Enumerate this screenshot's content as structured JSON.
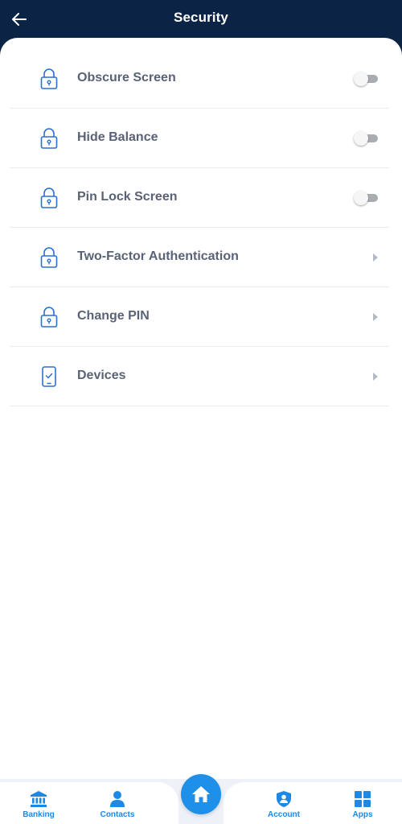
{
  "header": {
    "title": "Security",
    "back_icon": "arrow-left-icon"
  },
  "colors": {
    "header_bg": "#0b2344",
    "accent": "#1e88e5",
    "label": "#5a6275",
    "icon": "#2b6fd6",
    "toggle_track": "#a9acb1",
    "chevron": "#b5b9c2"
  },
  "settings": [
    {
      "label": "Obscure Screen",
      "icon": "lock-icon",
      "control": "toggle",
      "enabled": false
    },
    {
      "label": "Hide Balance",
      "icon": "lock-icon",
      "control": "toggle",
      "enabled": false
    },
    {
      "label": "Pin Lock Screen",
      "icon": "lock-icon",
      "control": "toggle",
      "enabled": false
    },
    {
      "label": "Two-Factor Authentication",
      "icon": "lock-icon",
      "control": "chevron"
    },
    {
      "label": "Change PIN",
      "icon": "lock-icon",
      "control": "chevron"
    },
    {
      "label": "Devices",
      "icon": "phone-check-icon",
      "control": "chevron"
    }
  ],
  "bottom_nav": {
    "banking": {
      "label": "Banking",
      "icon": "bank-icon"
    },
    "contacts": {
      "label": "Contacts",
      "icon": "person-icon"
    },
    "home": {
      "icon": "home-icon"
    },
    "account": {
      "label": "Account",
      "icon": "shield-user-icon"
    },
    "apps": {
      "label": "Apps",
      "icon": "grid-icon"
    }
  }
}
